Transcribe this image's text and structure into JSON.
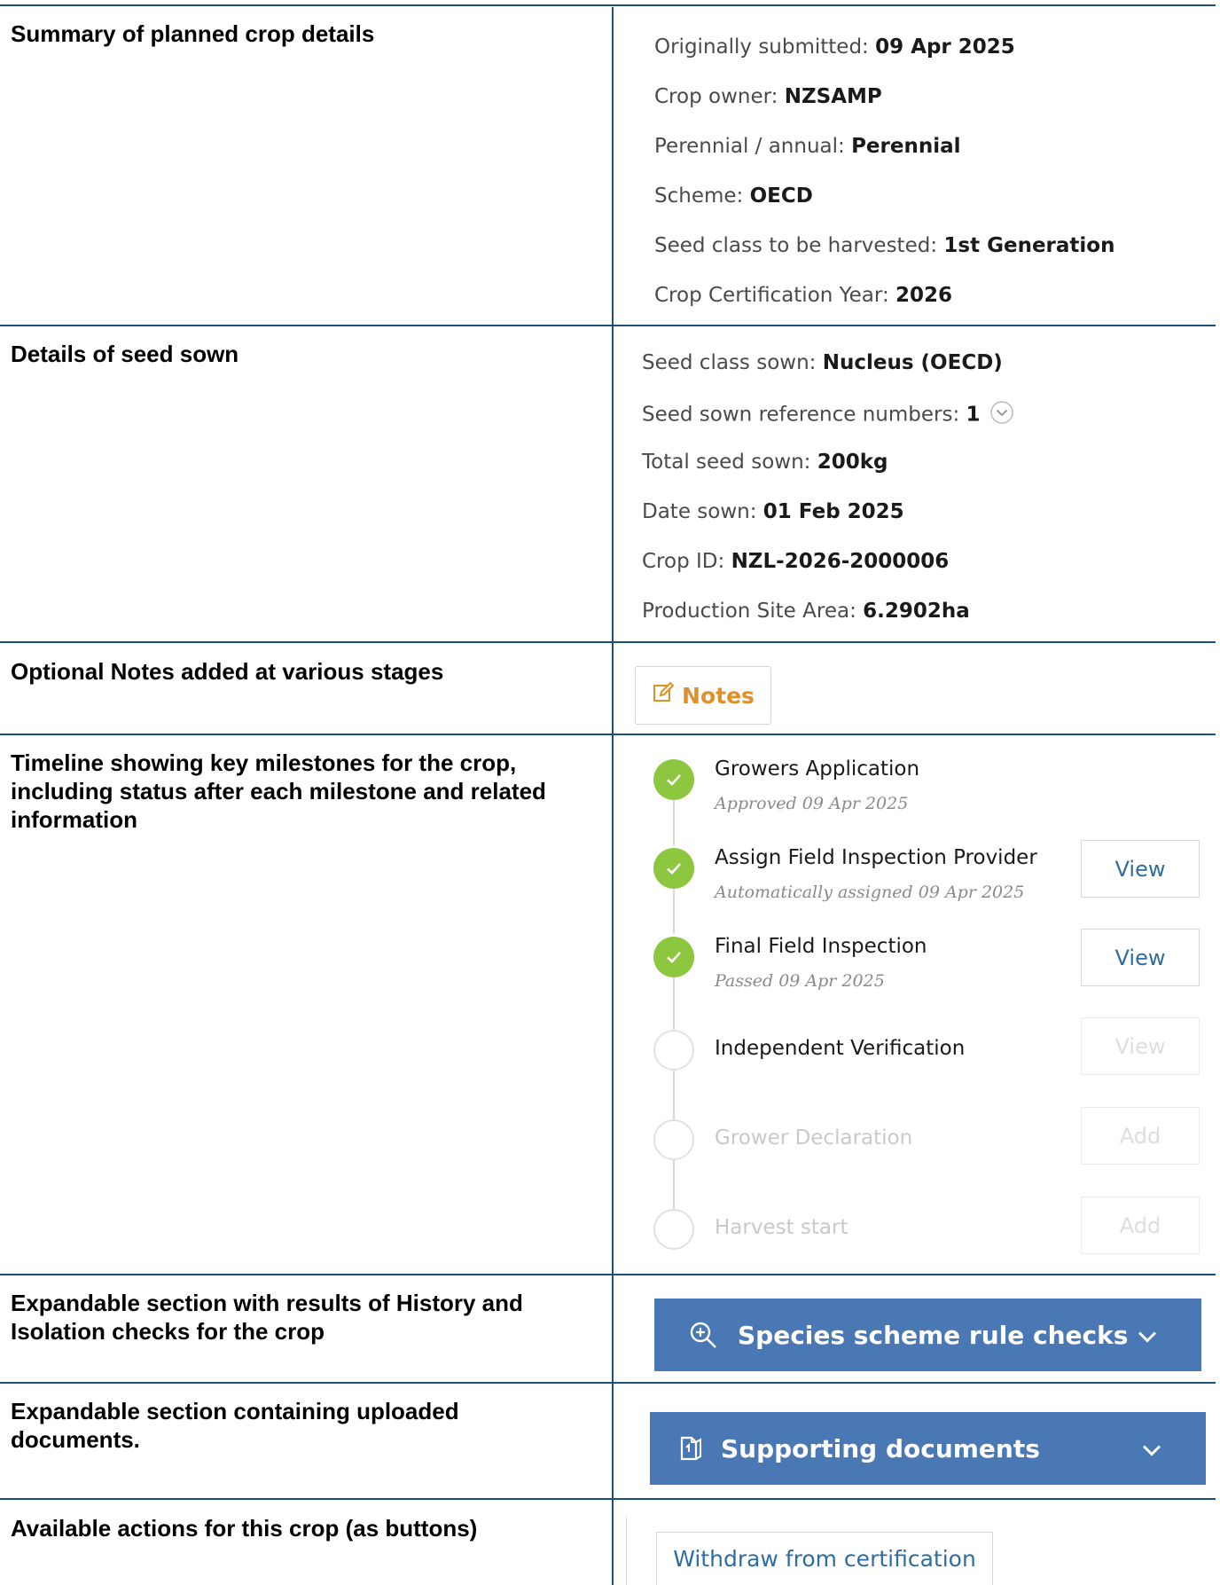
{
  "rows": [
    {
      "label": "Summary of planned crop details"
    },
    {
      "label": "Details of seed sown"
    },
    {
      "label": "Optional Notes added at various stages"
    },
    {
      "label": "Timeline showing key milestones for the crop, including status after each milestone and related information"
    },
    {
      "label": "Expandable section with results of History and Isolation checks for the crop"
    },
    {
      "label": "Expandable section containing uploaded documents."
    },
    {
      "label": "Available actions for this crop (as buttons)"
    }
  ],
  "summary": {
    "items": [
      {
        "key": "Originally submitted:",
        "value": "09 Apr 2025"
      },
      {
        "key": "Crop owner:",
        "value": "NZSAMP"
      },
      {
        "key": "Perennial / annual:",
        "value": "Perennial"
      },
      {
        "key": "Scheme:",
        "value": "OECD"
      },
      {
        "key": "Seed class to be harvested:",
        "value": "1st Generation"
      },
      {
        "key": "Crop Certification Year:",
        "value": "2026"
      }
    ]
  },
  "seed": {
    "items": [
      {
        "key": "Seed class sown:",
        "value": "Nucleus (OECD)"
      },
      {
        "key": "Seed sown reference numbers:",
        "value": "1"
      },
      {
        "key": "Total seed sown:",
        "value": "200kg"
      },
      {
        "key": "Date sown:",
        "value": "01 Feb 2025"
      },
      {
        "key": "Crop ID:",
        "value": "NZL-2026-2000006"
      },
      {
        "key": "Production Site Area:",
        "value": "6.2902ha"
      }
    ]
  },
  "notes": {
    "label": "Notes"
  },
  "timeline": {
    "milestones": [
      {
        "title": "Growers Application",
        "status": "Approved 09 Apr 2025",
        "button": ""
      },
      {
        "title": "Assign Field Inspection Provider",
        "status": "Automatically assigned 09 Apr 2025",
        "button": "View"
      },
      {
        "title": "Final Field Inspection",
        "status": "Passed 09 Apr 2025",
        "button": "View"
      },
      {
        "title": "Independent Verification",
        "status": "",
        "button": "View"
      },
      {
        "title": "Grower Declaration",
        "status": "",
        "button": "Add"
      },
      {
        "title": "Harvest start",
        "status": "",
        "button": "Add"
      }
    ]
  },
  "species_checks": {
    "label": "Species scheme rule checks"
  },
  "supporting_docs": {
    "label": "Supporting documents"
  },
  "actions": {
    "withdraw_label": "Withdraw from certification"
  },
  "colors": {
    "border": "#1f4e79",
    "bar": "#4a78b5",
    "done": "#8dc63f",
    "link": "#2e6da4",
    "notes": "#e0902a"
  }
}
